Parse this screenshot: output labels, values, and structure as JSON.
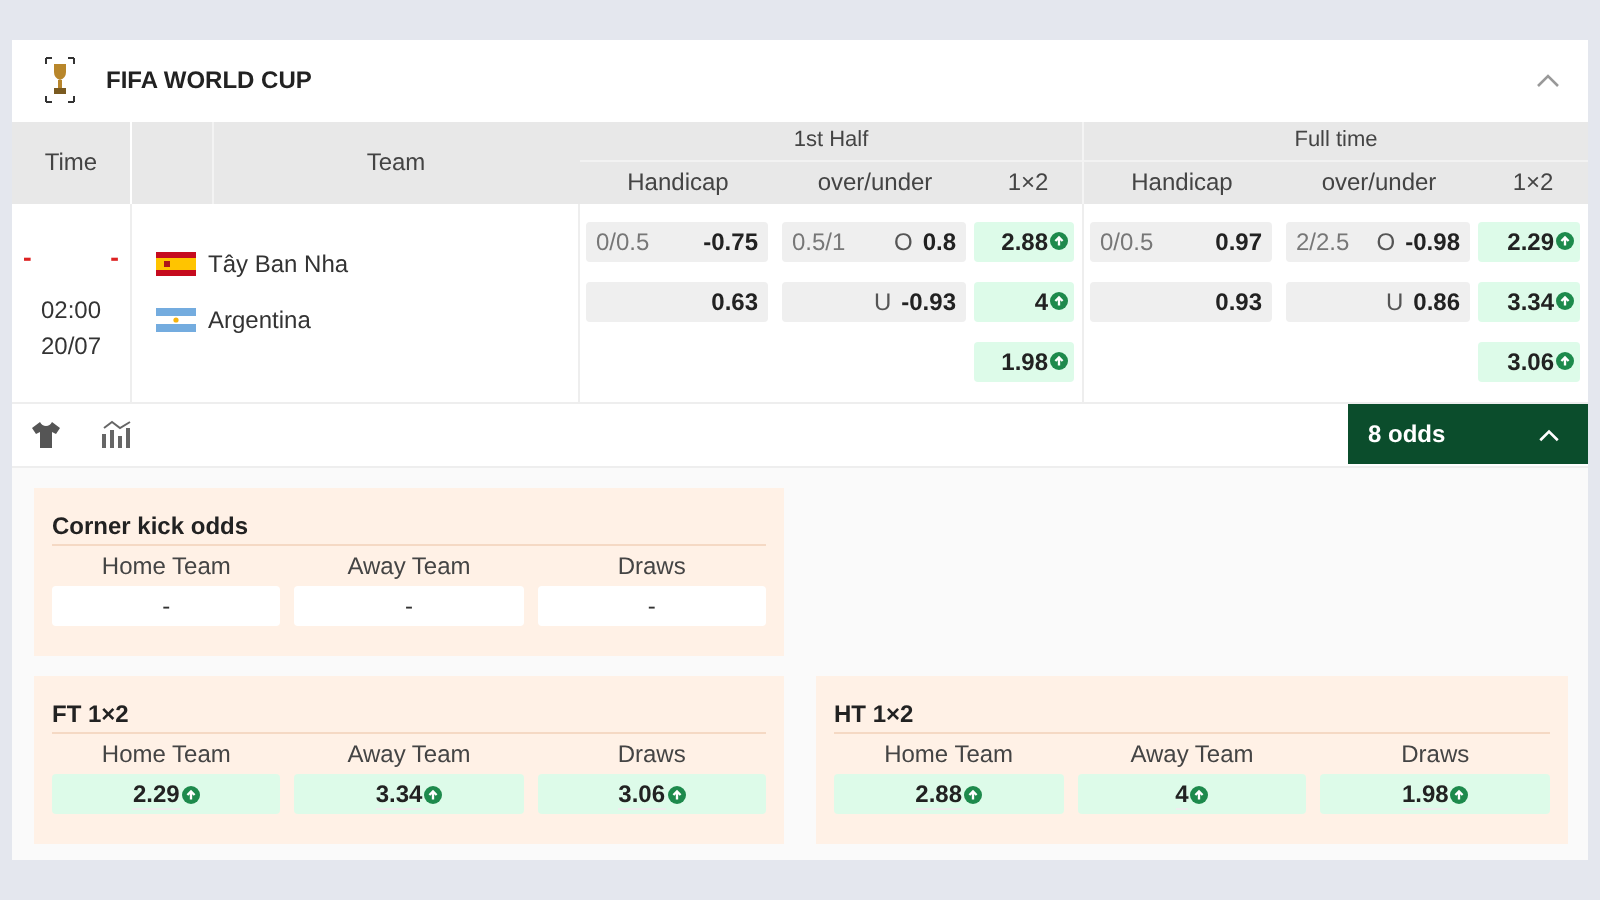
{
  "league": {
    "title": "FIFA WORLD CUP",
    "expanded": true
  },
  "table": {
    "columns": {
      "time": "Time",
      "team": "Team",
      "first_half": "1st Half",
      "full_time": "Full time",
      "sub": [
        "Handicap",
        "over/under",
        "1×2",
        "Handicap",
        "over/under",
        "1×2"
      ]
    },
    "match": {
      "score_home": "-",
      "score_away": "-",
      "time": "02:00",
      "date": "20/07",
      "teams": [
        {
          "name": "Tây Ban Nha",
          "kind": "spain"
        },
        {
          "name": "Argentina",
          "kind": "argentina"
        }
      ],
      "markets": [
        {
          "handicap": [
            {
              "line": "0/0.5",
              "value": "-0.75"
            },
            {
              "value": "0.63"
            }
          ],
          "over_under": [
            {
              "line": "0.5/1",
              "side": "O",
              "value": "0.8"
            },
            {
              "side": "U",
              "value": "-0.93"
            }
          ],
          "x12": [
            {
              "value": "2.88",
              "rising": true
            },
            {
              "value": "4",
              "rising": true
            },
            {
              "value": "1.98",
              "rising": true
            }
          ]
        },
        {
          "handicap": [
            {
              "line": "0/0.5",
              "value": "0.97"
            },
            {
              "value": "0.93"
            }
          ],
          "over_under": [
            {
              "line": "2/2.5",
              "side": "O",
              "value": "-0.98"
            },
            {
              "side": "U",
              "value": "0.86"
            }
          ],
          "x12": [
            {
              "value": "2.29",
              "rising": true
            },
            {
              "value": "3.34",
              "rising": true
            },
            {
              "value": "3.06",
              "rising": true
            }
          ]
        }
      ]
    }
  },
  "odds_button": {
    "label": "8 odds",
    "expanded": true
  },
  "panels": [
    {
      "title": "Corner kick odds",
      "kind": "plain",
      "cells": [
        {
          "label": "Home Team",
          "value": "-"
        },
        {
          "label": "Away Team",
          "value": "-"
        },
        {
          "label": "Draws",
          "value": "-"
        }
      ]
    },
    {
      "title": "FT 1×2",
      "kind": "odds",
      "cells": [
        {
          "label": "Home Team",
          "value": "2.29",
          "rising": true
        },
        {
          "label": "Away Team",
          "value": "3.34",
          "rising": true
        },
        {
          "label": "Draws",
          "value": "3.06",
          "rising": true
        }
      ]
    },
    {
      "title": "HT 1×2",
      "kind": "odds",
      "cells": [
        {
          "label": "Home Team",
          "value": "2.88",
          "rising": true
        },
        {
          "label": "Away Team",
          "value": "4",
          "rising": true
        },
        {
          "label": "Draws",
          "value": "1.98",
          "rising": true
        }
      ]
    }
  ]
}
